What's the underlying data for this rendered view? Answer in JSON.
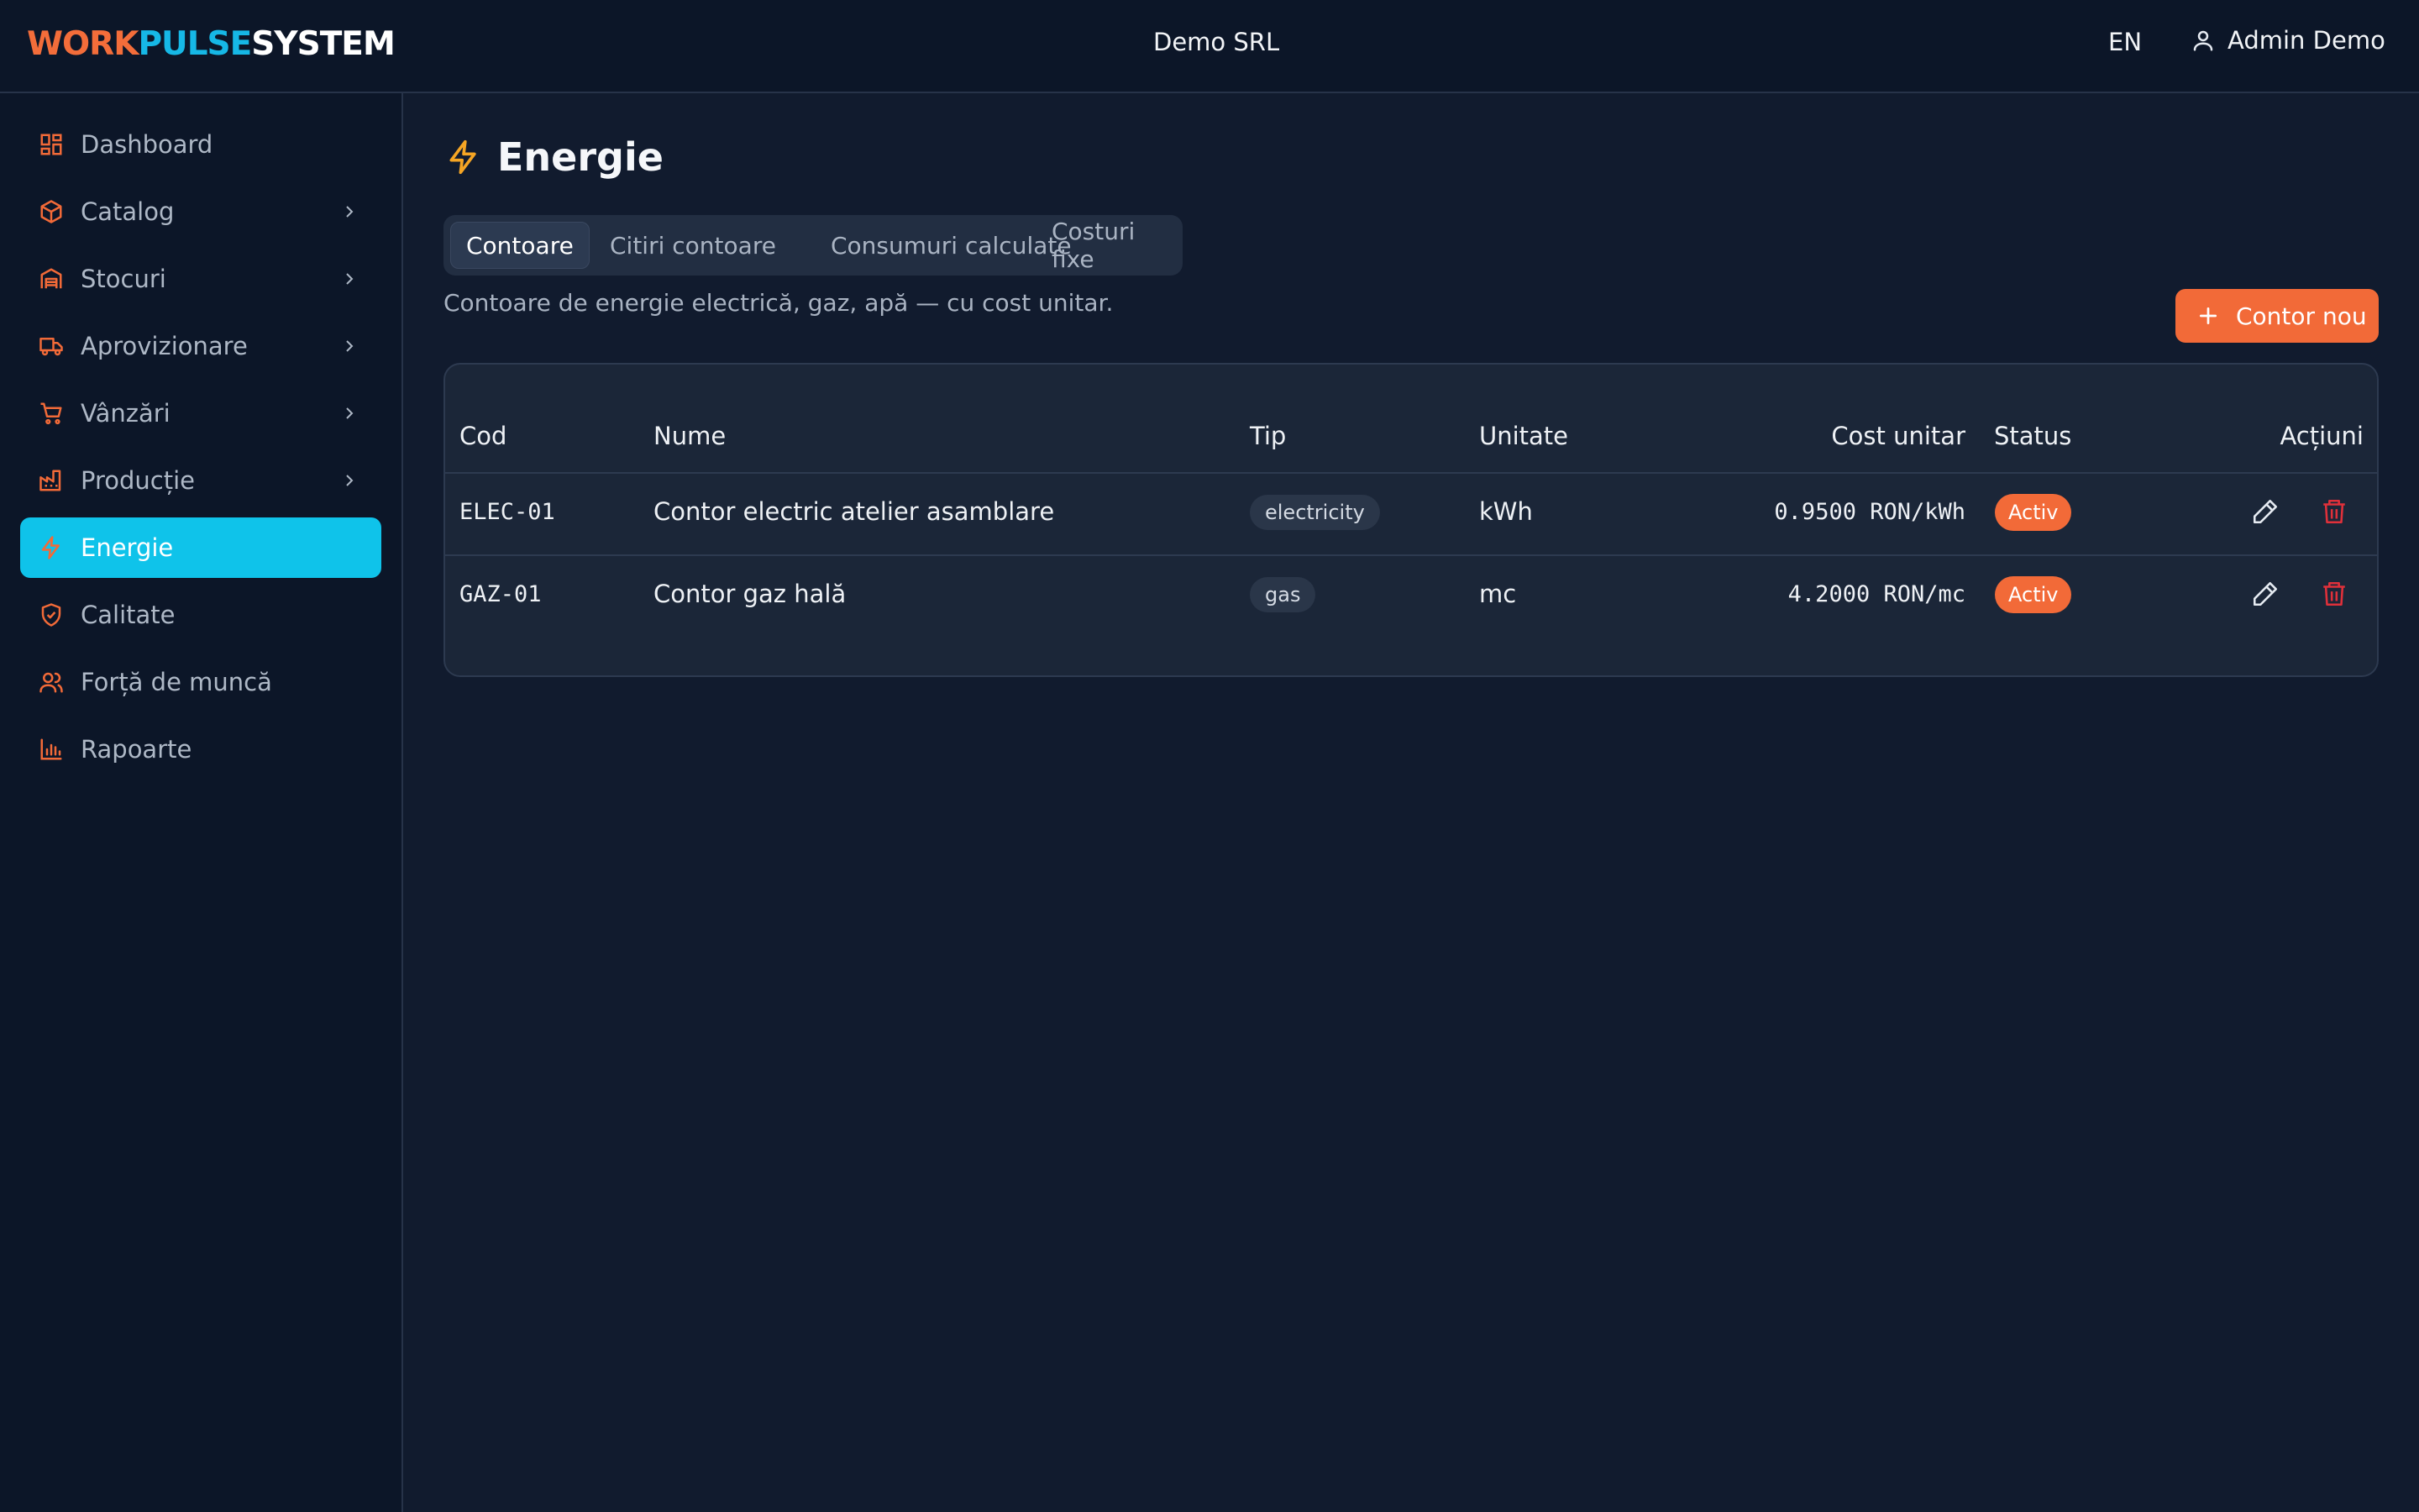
{
  "header": {
    "logo_part1": "WORK",
    "logo_part2": "PULSE",
    "logo_part3": "SYSTEM",
    "company": "Demo SRL",
    "language": "EN",
    "user": "Admin Demo"
  },
  "sidebar": {
    "items": [
      {
        "label": "Dashboard",
        "icon": "dashboard-icon"
      },
      {
        "label": "Catalog",
        "icon": "box-icon"
      },
      {
        "label": "Stocuri",
        "icon": "warehouse-icon"
      },
      {
        "label": "Aprovizionare",
        "icon": "truck-icon"
      },
      {
        "label": "Vânzări",
        "icon": "cart-icon"
      },
      {
        "label": "Producție",
        "icon": "factory-icon"
      },
      {
        "label": "Energie",
        "icon": "lightning-icon"
      },
      {
        "label": "Calitate",
        "icon": "shield-check-icon"
      },
      {
        "label": "Forță de muncă",
        "icon": "users-icon"
      },
      {
        "label": "Rapoarte",
        "icon": "bar-chart-icon"
      }
    ],
    "active": "Energie"
  },
  "page": {
    "title": "Energie",
    "description": "Contoare de energie electrică, gaz, apă — cu cost unitar.",
    "new_button": "Contor nou",
    "tabs": [
      "Contoare",
      "Citiri contoare",
      "Consumuri calculate",
      "Costuri fixe"
    ],
    "active_tab": "Contoare"
  },
  "table": {
    "columns": [
      "Cod",
      "Nume",
      "Tip",
      "Unitate",
      "Cost unitar",
      "Status",
      "Acțiuni"
    ],
    "rows": [
      {
        "cod": "ELEC-01",
        "nume": "Contor electric atelier asamblare",
        "tip": "electricity",
        "unitate": "kWh",
        "cost": "0.9500 RON/kWh",
        "status": "Activ"
      },
      {
        "cod": "GAZ-01",
        "nume": "Contor gaz hală",
        "tip": "gas",
        "unitate": "mc",
        "cost": "4.2000 RON/mc",
        "status": "Activ"
      }
    ]
  },
  "colors": {
    "accent": "#f26a38",
    "active_nav": "#0fc3ea",
    "background": "#111b2e",
    "danger": "#e0303a"
  }
}
